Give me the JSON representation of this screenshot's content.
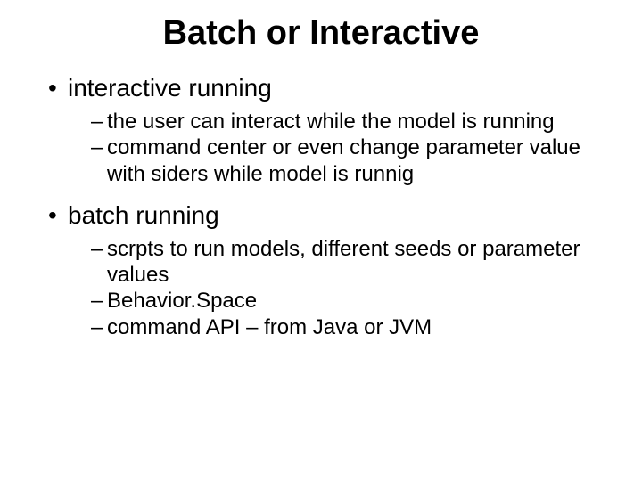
{
  "title": "Batch or Interactive",
  "bullets": [
    {
      "text": "interactive running",
      "sub": [
        "the user can interact while the model is running",
        "command center or even change parameter value with siders while model is runnig"
      ]
    },
    {
      "text": "batch running",
      "sub": [
        "scrpts to run models, different seeds or parameter values",
        "Behavior.Space",
        "command API – from Java or JVM"
      ]
    }
  ]
}
